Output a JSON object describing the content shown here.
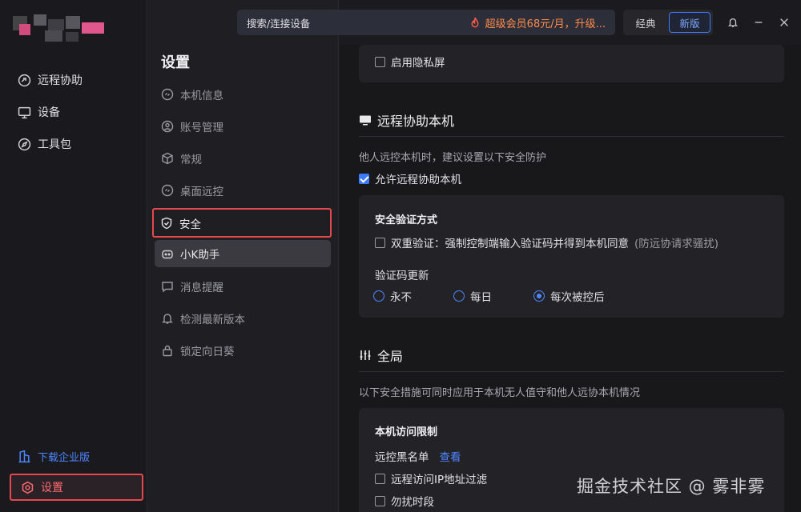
{
  "topbar": {
    "search_label": "搜索/连接设备",
    "promo_text": "超级会员68元/月，升级...",
    "mode_classic": "经典",
    "mode_new": "新版"
  },
  "sidebar": {
    "items": [
      {
        "label": "远程协助",
        "icon": "remote-assist-icon"
      },
      {
        "label": "设备",
        "icon": "monitor-icon"
      },
      {
        "label": "工具包",
        "icon": "compass-icon"
      }
    ],
    "enterprise_label": "下载企业版",
    "settings_label": "设置"
  },
  "settings_menu": {
    "title": "设置",
    "items": [
      {
        "label": "本机信息",
        "icon": "link-icon"
      },
      {
        "label": "账号管理",
        "icon": "user-gear-icon"
      },
      {
        "label": "常规",
        "icon": "cube-icon"
      },
      {
        "label": "桌面远控",
        "icon": "link-icon"
      },
      {
        "label": "安全",
        "icon": "shield-icon"
      },
      {
        "label": "小K助手",
        "icon": "robot-icon"
      },
      {
        "label": "消息提醒",
        "icon": "message-icon"
      },
      {
        "label": "检测最新版本",
        "icon": "bell-icon"
      },
      {
        "label": "锁定向日葵",
        "icon": "lock-icon"
      }
    ]
  },
  "main": {
    "privacy_screen_label": "启用隐私屏",
    "remote_section_title": "远程协助本机",
    "remote_desc": "他人远控本机时，建议设置以下安全防护",
    "allow_remote_label": "允许远程协助本机",
    "security_verify_title": "安全验证方式",
    "double_verify_label": "双重验证：强制控制端输入验证码并得到本机同意",
    "double_verify_hint": "(防远协请求骚扰)",
    "code_update_title": "验证码更新",
    "radio_options": [
      "永不",
      "每日",
      "每次被控后"
    ],
    "selected_radio": "每次被控后",
    "global_section_title": "全局",
    "global_desc": "以下安全措施可同时应用于本机无人值守和他人远协本机情况",
    "access_limit_title": "本机访问限制",
    "blacklist_label": "远控黑名单",
    "blacklist_link": "查看",
    "ip_filter_label": "远程访问IP地址过滤",
    "dnd_label": "勿扰时段"
  },
  "watermark": "掘金技术社区 @ 雾非雾",
  "colors": {
    "accent": "#3c7bff",
    "highlight_border": "#e5484d",
    "promo": "#ff8a4a"
  }
}
